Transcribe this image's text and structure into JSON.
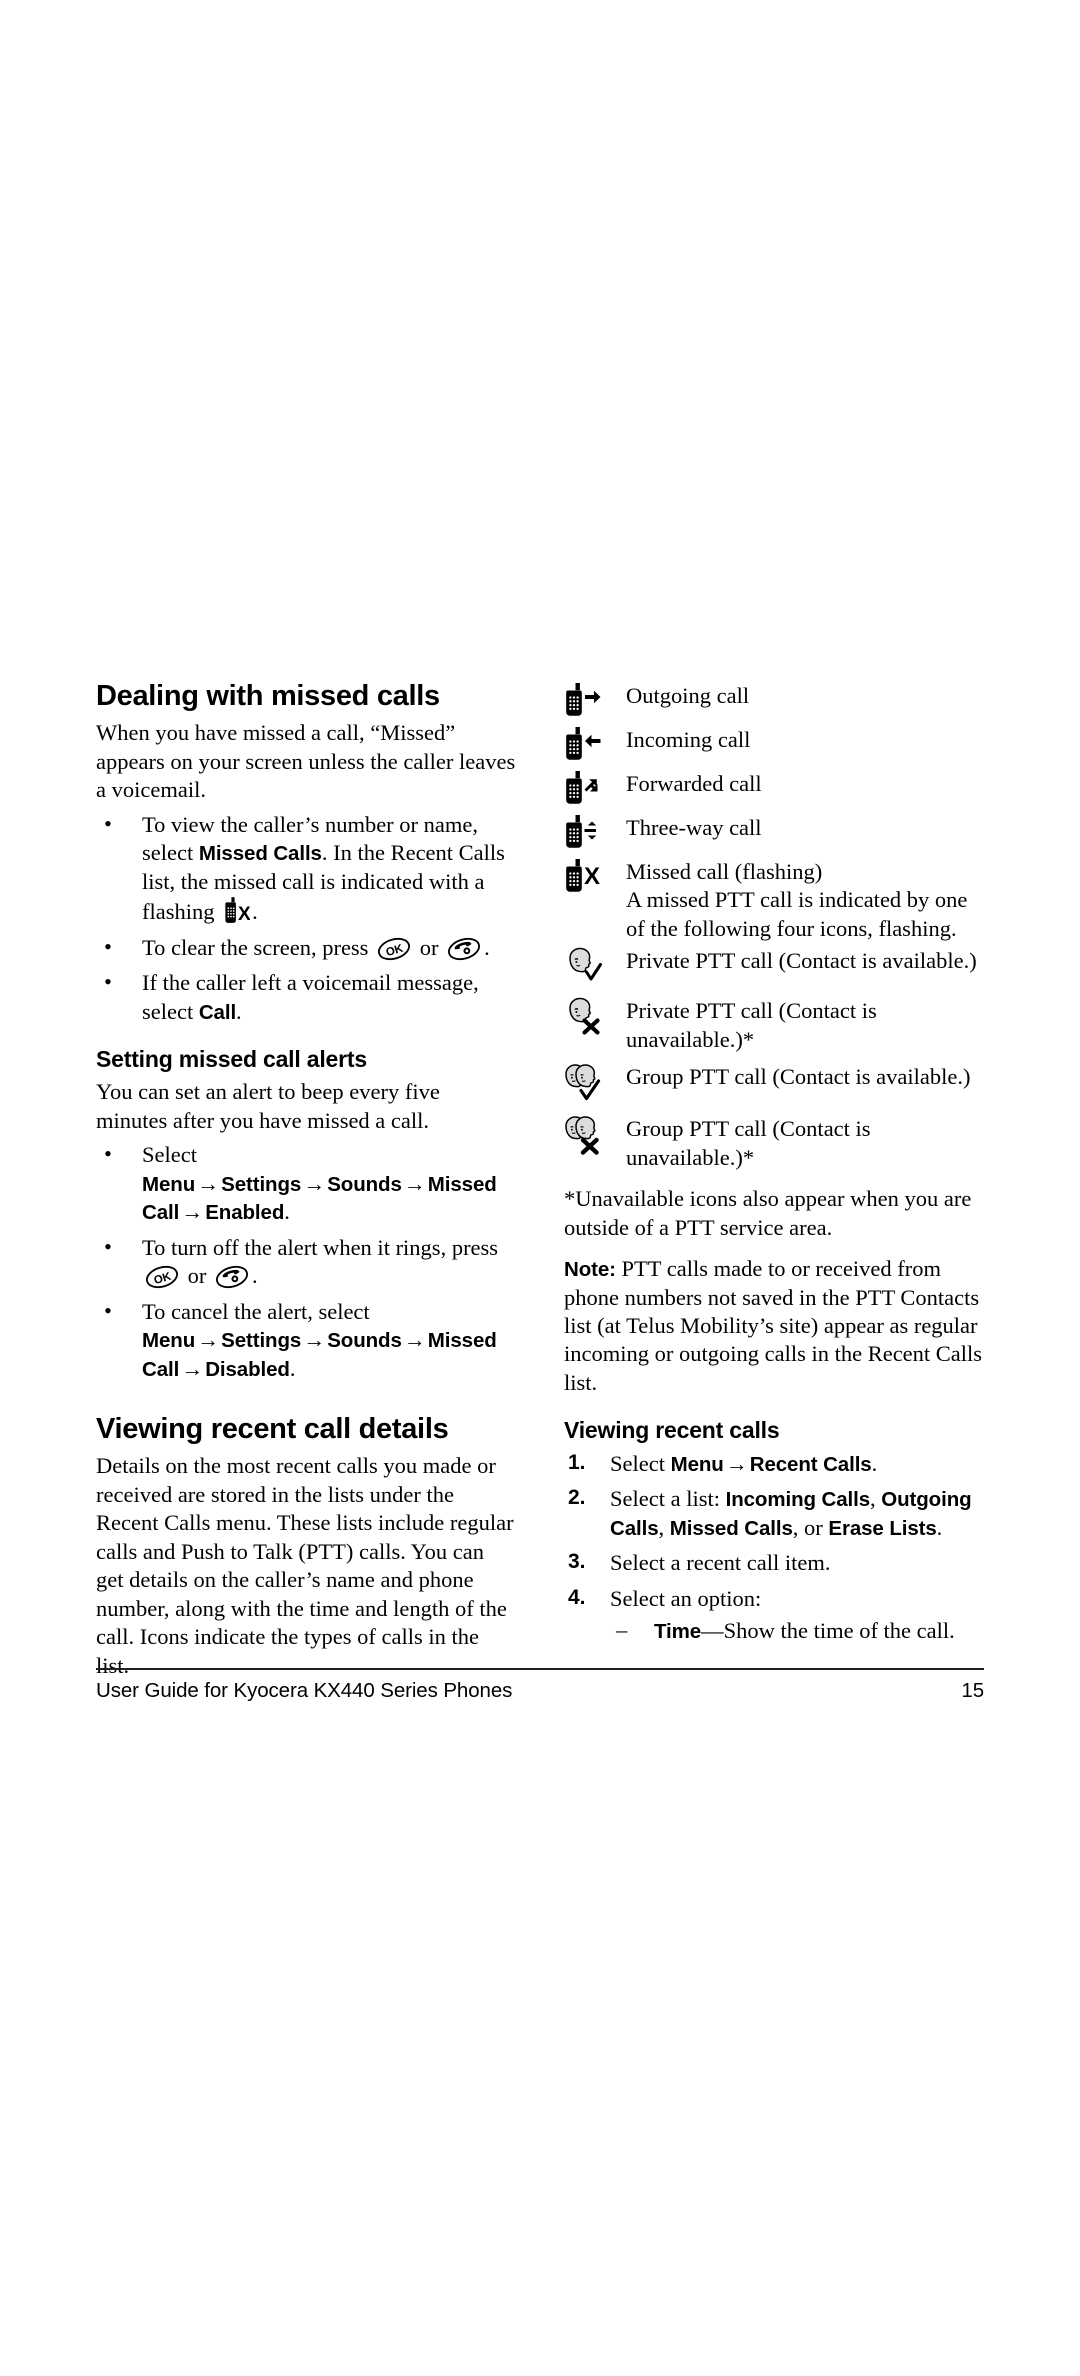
{
  "document": {
    "footer_text": "User Guide for Kyocera KX440 Series Phones",
    "page_number": "15"
  },
  "left_column": {
    "heading_missed": "Dealing with missed calls",
    "intro_missed": "When you have missed a call, “Missed” appears on your screen unless the caller leaves a voicemail.",
    "bullets_missed": [
      {
        "pre": "To view the caller’s number or name, select ",
        "bold1": "Missed Calls",
        "mid": ". In the Recent Calls list, the missed call is indicated with a flashing ",
        "icon": "phone-missed-icon",
        "post": "."
      },
      {
        "pre": "To clear the screen, press ",
        "icon1": "ok-key-icon",
        "mid": " or ",
        "icon2": "end-call-key-icon",
        "post": "."
      },
      {
        "pre": "If the caller left a voicemail message, select ",
        "bold1": "Call",
        "post": "."
      }
    ],
    "heading_alerts": "Setting missed call alerts",
    "intro_alerts": "You can set an alert to beep every five minutes after you have missed a call.",
    "bullets_alerts": [
      {
        "pre": "Select ",
        "path": [
          "Menu",
          "Settings",
          "Sounds",
          "Missed Call",
          "Enabled"
        ],
        "post": "."
      },
      {
        "pre": "To turn off the alert when it rings, press ",
        "icon1": "ok-key-icon",
        "mid": " or ",
        "icon2": "end-call-key-icon",
        "post": "."
      },
      {
        "pre": "To cancel the alert, select ",
        "path": [
          "Menu",
          "Settings",
          "Sounds",
          "Missed Call",
          "Disabled"
        ],
        "post": "."
      }
    ],
    "heading_details": "Viewing recent call details",
    "body_details": "Details on the most recent calls you made or received are stored in the lists under the Recent Calls menu. These lists include regular calls and Push to Talk (PTT) calls. You can get details on the caller’s name and phone number, along with the time and length of the call. Icons indicate the types of calls in the list."
  },
  "right_column": {
    "icon_legend": [
      {
        "icon": "phone-outgoing-icon",
        "label": "Outgoing call"
      },
      {
        "icon": "phone-incoming-icon",
        "label": "Incoming call"
      },
      {
        "icon": "phone-forwarded-icon",
        "label": "Forwarded call"
      },
      {
        "icon": "phone-three-way-icon",
        "label": "Three-way call"
      },
      {
        "icon": "phone-missed-icon",
        "label": "Missed call (flashing)"
      }
    ],
    "missed_ptt_note": "A missed PTT call is indicated by one of the following four icons, flashing.",
    "ptt_legend": [
      {
        "icon": "private-ptt-available-icon",
        "label": "Private PTT call (Contact is available.)"
      },
      {
        "icon": "private-ptt-unavailable-icon",
        "label": "Private PTT call (Contact is unavailable.)*"
      },
      {
        "icon": "group-ptt-available-icon",
        "label": "Group PTT call (Contact is available.)"
      },
      {
        "icon": "group-ptt-unavailable-icon",
        "label": "Group PTT call (Contact is unavailable.)*"
      }
    ],
    "footnote": "*Unavailable icons also appear when you are outside of a PTT service area.",
    "note_label": "Note:",
    "note_text": " PTT calls made to or received from phone numbers not saved in the PTT Contacts list (at Telus Mobility’s site) appear as regular incoming or outgoing calls in the Recent Calls list.",
    "heading_viewing": "Viewing recent calls",
    "steps": [
      {
        "num": "1.",
        "pre": "Select ",
        "path": [
          "Menu",
          "Recent Calls"
        ],
        "post": "."
      },
      {
        "num": "2.",
        "pre": "Select a list: ",
        "bold1": "Incoming Calls",
        "sep1": ", ",
        "bold2": "Outgoing Calls",
        "sep2": ", ",
        "bold3": "Missed Calls",
        "sep3": ", or ",
        "bold4": "Erase Lists",
        "post": "."
      },
      {
        "num": "3.",
        "pre": "Select a recent call item.",
        "post": ""
      },
      {
        "num": "4.",
        "pre": "Select an option:",
        "post": ""
      }
    ],
    "sub_option": {
      "bold": "Time",
      "text": "—Show the time of the call."
    }
  },
  "colors": {
    "text": "#000000",
    "rule": "#231f20",
    "icon_fill": "#000000",
    "face_fill": "#d9d9d9"
  }
}
